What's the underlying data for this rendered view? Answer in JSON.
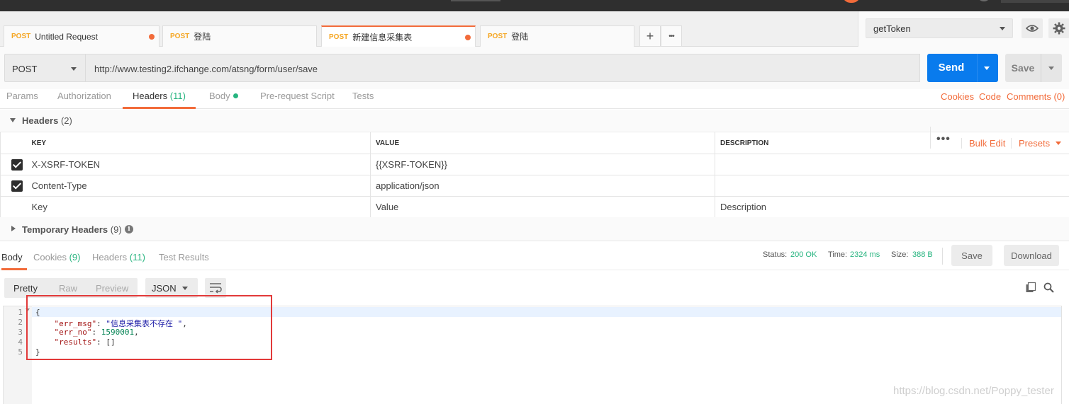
{
  "tabs": [
    {
      "method": "POST",
      "name": "Untitled Request",
      "unsaved": true
    },
    {
      "method": "POST",
      "name": "登陆",
      "unsaved": false
    },
    {
      "method": "POST",
      "name": "新建信息采集表",
      "unsaved": true,
      "active": true
    },
    {
      "method": "POST",
      "name": "登陆",
      "unsaved": false
    }
  ],
  "tab_actions": {
    "add_icon": "plus-icon",
    "more_icon": "ellipsis-icon",
    "add": "+",
    "more": "•••"
  },
  "environment": {
    "selected": "getToken",
    "eye_icon": "eye-icon",
    "settings_icon": "gear-icon"
  },
  "request": {
    "method": "POST",
    "url": "http://www.testing2.ifchange.com/atsng/form/user/save",
    "send_label": "Send",
    "save_label": "Save"
  },
  "request_tabs": {
    "params": "Params",
    "authorization": "Authorization",
    "headers": "Headers",
    "headers_count": "(11)",
    "body": "Body",
    "prerequest": "Pre-request Script",
    "tests": "Tests",
    "active": "headers"
  },
  "right_links": {
    "cookies": "Cookies",
    "code": "Code",
    "comments": "Comments (0)"
  },
  "headers_section": {
    "title": "Headers",
    "count": "(2)",
    "columns": {
      "key": "KEY",
      "value": "VALUE",
      "description": "DESCRIPTION"
    },
    "bulk_edit": "Bulk Edit",
    "presets": "Presets",
    "rows": [
      {
        "checked": true,
        "key": "X-XSRF-TOKEN",
        "value": "{{XSRF-TOKEN}}",
        "description": ""
      },
      {
        "checked": true,
        "key": "Content-Type",
        "value": "application/json",
        "description": ""
      }
    ],
    "placeholders": {
      "key": "Key",
      "value": "Value",
      "description": "Description"
    }
  },
  "temporary_headers": {
    "title": "Temporary Headers",
    "count": "(9)",
    "info_icon": "info-icon",
    "info_glyph": "i"
  },
  "response_tabs": {
    "body": "Body",
    "cookies": "Cookies",
    "cookies_count": "(9)",
    "headers": "Headers",
    "headers_count": "(11)",
    "test_results": "Test Results"
  },
  "response_status": {
    "status_label": "Status:",
    "status": "200 OK",
    "time_label": "Time:",
    "time": "2324 ms",
    "size_label": "Size:",
    "size": "388 B",
    "save": "Save",
    "download": "Download"
  },
  "view_modes": {
    "pretty": "Pretty",
    "raw": "Raw",
    "preview": "Preview",
    "active": "pretty",
    "format": "JSON"
  },
  "response_body": {
    "line_numbers": [
      "1",
      "2",
      "3",
      "4",
      "5"
    ],
    "open_brace": "{",
    "close_brace": "}",
    "err_msg_key": "\"err_msg\"",
    "err_msg_value": "\"信息采集表不存在 \"",
    "err_no_key": "\"err_no\"",
    "err_no_value": "1590001",
    "results_key": "\"results\"",
    "results_value": "[]"
  },
  "watermark": "https://blog.csdn.net/Poppy_tester",
  "colors": {
    "accent": "#f26b3a",
    "send": "#097bed",
    "success": "#26b47f",
    "highlight_box": "#e23a3a"
  }
}
